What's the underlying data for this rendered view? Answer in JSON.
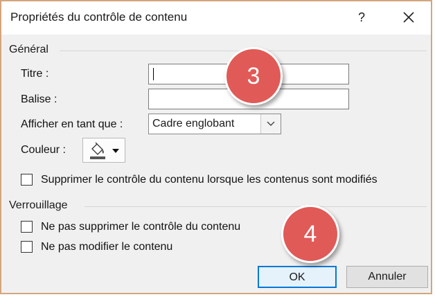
{
  "dialog": {
    "title": "Propriétés du contrôle de contenu",
    "help_label": "?",
    "close_label": "✕"
  },
  "general": {
    "group_label": "Général",
    "title_label": "Titre :",
    "tag_label": "Balise :",
    "display_label": "Afficher en tant que :",
    "display_value": "Cadre englobant",
    "color_label": "Couleur :",
    "remove_checkbox_label": "Supprimer le contrôle du contenu lorsque les contenus sont modifiés",
    "remove_checked": false
  },
  "locking": {
    "group_label": "Verrouillage",
    "no_delete_label": "Ne pas supprimer le contrôle du contenu",
    "no_delete_checked": false,
    "no_edit_label": "Ne pas modifier le contenu",
    "no_edit_checked": false
  },
  "buttons": {
    "ok": "OK",
    "cancel": "Annuler"
  },
  "annotations": {
    "badge_3": "3",
    "badge_4": "4",
    "badge_color": "#e05a57"
  },
  "colors": {
    "ok_border": "#0078d7",
    "window_border": "#d4a57c"
  }
}
